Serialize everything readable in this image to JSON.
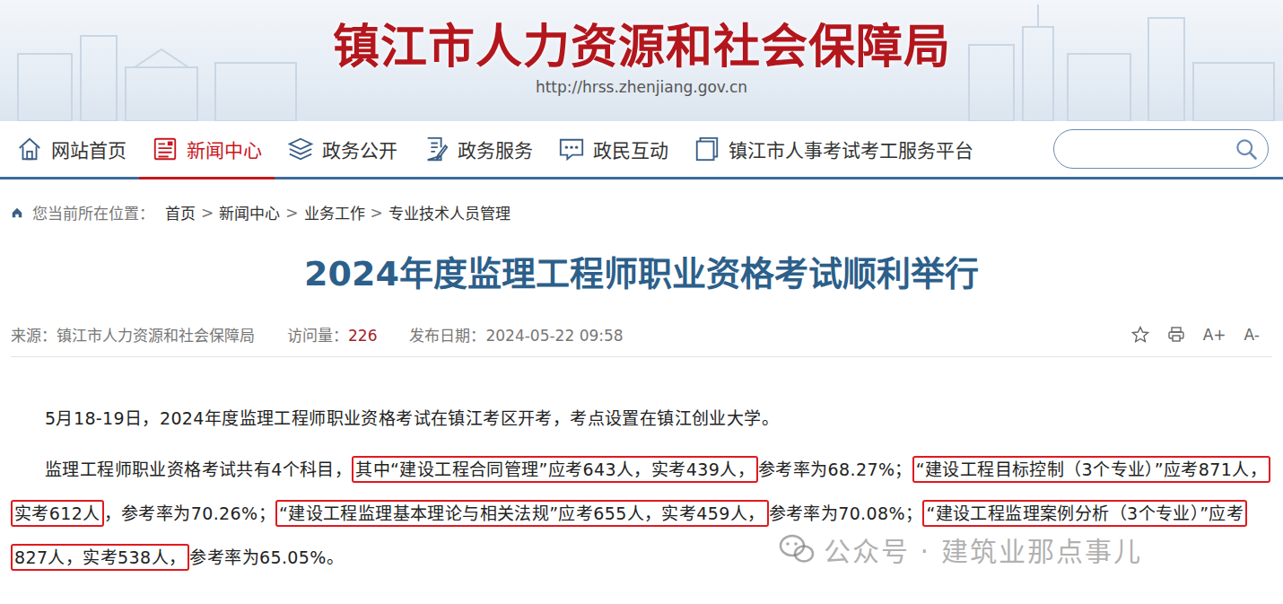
{
  "header": {
    "title": "镇江市人力资源和社会保障局",
    "url": "http://hrss.zhenjiang.gov.cn"
  },
  "nav": {
    "items": [
      {
        "label": "网站首页",
        "selected": false
      },
      {
        "label": "新闻中心",
        "selected": true
      },
      {
        "label": "政务公开",
        "selected": false
      },
      {
        "label": "政务服务",
        "selected": false
      },
      {
        "label": "政民互动",
        "selected": false
      },
      {
        "label": "镇江市人事考试考工服务平台",
        "selected": false
      }
    ]
  },
  "breadcrumb": {
    "prefix": "您当前所在位置：",
    "separator": ">",
    "items": [
      "首页",
      "新闻中心",
      "业务工作",
      "专业技术人员管理"
    ]
  },
  "article": {
    "title": "2024年度监理工程师职业资格考试顺利举行",
    "meta": {
      "source_label": "来源：",
      "source": "镇江市人力资源和社会保障局",
      "views_label": "访问量：",
      "views": "226",
      "date_label": "发布日期：",
      "date": "2024-05-22 09:58"
    },
    "font_tools": [
      "A+",
      "A-"
    ],
    "paragraphs": [
      {
        "segments": [
          {
            "text": "5月18-19日，2024年度监理工程师职业资格考试在镇江考区开考，考点设置在镇江创业大学。",
            "highlighted": false
          }
        ]
      },
      {
        "segments": [
          {
            "text": "监理工程师职业资格考试共有4个科目，",
            "highlighted": false
          },
          {
            "text": "其中“建设工程合同管理”应考643人，实考439人，",
            "highlighted": true
          },
          {
            "text": "参考率为68.27%；",
            "highlighted": false
          },
          {
            "text": "“建设工程目标控制（3个专业）”应考871人，实考612人",
            "highlighted": true
          },
          {
            "text": "，参考率为70.26%；",
            "highlighted": false
          },
          {
            "text": "“建设工程监理基本理论与相关法规”应考655人，实考459人，",
            "highlighted": true
          },
          {
            "text": "参考率为70.08%；",
            "highlighted": false
          },
          {
            "text": "“建设工程监理案例分析（3个专业）”应考827人，实考538人，",
            "highlighted": true
          },
          {
            "text": "参考率为65.05%。",
            "highlighted": false
          }
        ]
      }
    ]
  },
  "watermark": {
    "text": "公众号 · 建筑业那点事儿"
  }
}
